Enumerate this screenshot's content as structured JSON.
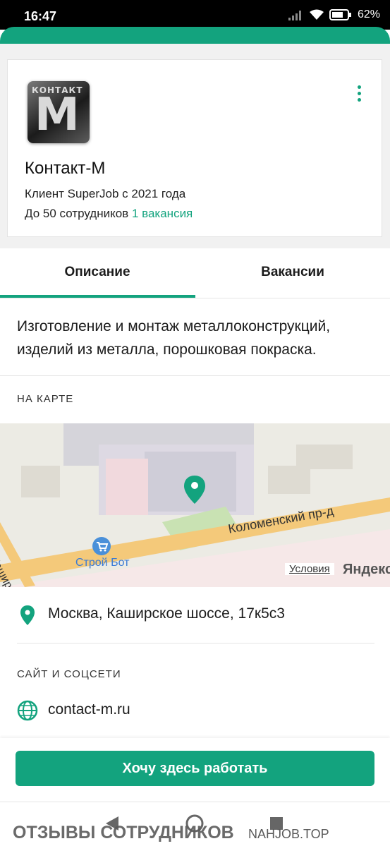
{
  "status_bar": {
    "time": "16:47",
    "battery": "62%"
  },
  "company": {
    "name": "Контакт-М",
    "client_since": "Клиент SuperJob с 2021 года",
    "employees_prefix": "До 50 сотрудников",
    "vacancies_link": "1 вакансия",
    "logo_text_top": "КОНТАКТ",
    "logo_text_main": "M"
  },
  "tabs": [
    {
      "label": "Описание",
      "active": true
    },
    {
      "label": "Вакансии",
      "active": false
    }
  ],
  "description": "Изготовление и монтаж металлоконструкций, изделий из металла, порошковая покраска.",
  "map_section": {
    "title": "НА КАРТЕ",
    "street_label": "Коломенский пр-д",
    "poi_label": "Строй Бот",
    "side_street_label": "Кашир",
    "terms_link": "Условия",
    "provider": "Яндекс"
  },
  "address": "Москва, Каширское шоссе, 17к5с3",
  "social_section": {
    "title": "САЙТ И СОЦСЕТИ",
    "site": "contact-m.ru"
  },
  "cta_button": "Хочу здесь работать",
  "watermark": {
    "left": "ОТЗЫВЫ СОТРУДНИКОВ",
    "right": "NAHJOB.TOP"
  },
  "colors": {
    "accent": "#13a37e",
    "map_road": "#f4c97a",
    "map_bg": "#ecebe4"
  },
  "icons": [
    "signal-icon",
    "wifi-icon",
    "battery-icon",
    "more-vert-icon",
    "map-pin-icon",
    "location-pin-icon",
    "globe-icon",
    "back-icon",
    "home-icon",
    "recents-icon",
    "shopping-cart-icon"
  ]
}
